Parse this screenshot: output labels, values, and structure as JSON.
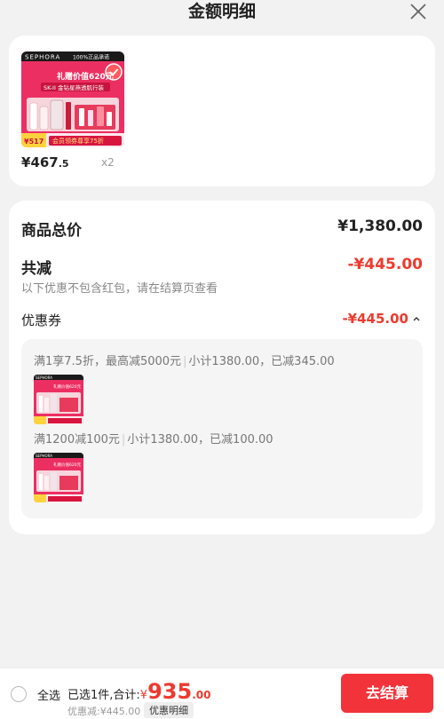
{
  "header": {
    "title": "金额明细",
    "close_icon": "close-icon"
  },
  "product": {
    "image": {
      "brand": "SEPHORA",
      "tag": "100%正品承诺",
      "gift_text": "礼赠价值620元",
      "subtitle": "SK-II 金钻星燕透肌行装",
      "coupon_banner": "会员领券尊享75折",
      "promo_price": "517",
      "check_icon": "check-icon"
    },
    "price_symbol": "¥",
    "price_int": "467",
    "price_dec": ".5",
    "qty": "x2"
  },
  "summary": {
    "total_label": "商品总价",
    "total_value": "¥1,380.00",
    "reduce_label": "共减",
    "reduce_value": "-¥445.00",
    "reduce_note": "以下优惠不包含红包，请在结算页查看",
    "coupon_label": "优惠券",
    "coupon_value": "-¥445.00",
    "coupon_toggle_icon": "chevron-up-icon"
  },
  "coupon_details": [
    {
      "text": "满1享7.5折，最高减5000元",
      "subtotal": "小计1380.00，已减345.00"
    },
    {
      "text": "满1200减100元",
      "subtotal": "小计1380.00，已减100.00"
    }
  ],
  "footer": {
    "select_all": "全选",
    "selected_text": "已选1件,合计:",
    "currency": "¥",
    "total_int": "935",
    "total_dec": ".00",
    "discount_text": "优惠减:¥445.00",
    "detail_button": "优惠明细",
    "checkout_button": "去结算"
  },
  "colors": {
    "accent": "#ee3a2e",
    "checkout": "#f2333a",
    "product_bg": "#ec2f62"
  }
}
